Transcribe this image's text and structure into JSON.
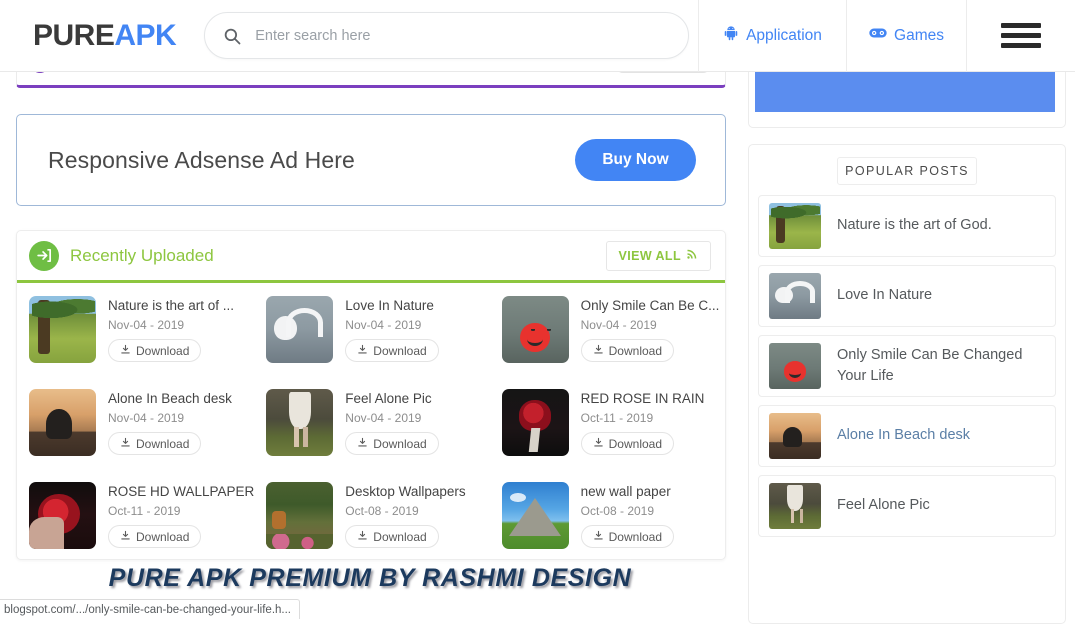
{
  "header": {
    "logo_pure": "PURE",
    "logo_apk": "APK",
    "search_placeholder": "Enter search here",
    "search_value": "",
    "nav": [
      {
        "label": "Application",
        "icon": "android-icon"
      },
      {
        "label": "Games",
        "icon": "gamepad-icon"
      }
    ],
    "menu_icon": "hamburger-menu-icon"
  },
  "ad": {
    "text": "Responsive Adsense Ad Here",
    "button_label": "Buy Now",
    "button_color": "#4285f4"
  },
  "recent": {
    "section_title": "Recently Uploaded",
    "badge_icon": "sign-in-arrow-icon",
    "view_all_label": "VIEW ALL",
    "view_all_icon": "rss-icon",
    "accent_color": "#8dc63f",
    "download_label": "Download",
    "items": [
      {
        "title": "Nature is the art of ...",
        "date": "Nov-04 - 2019",
        "art": "art-nature"
      },
      {
        "title": "Love In Nature",
        "date": "Nov-04 - 2019",
        "art": "art-swan"
      },
      {
        "title": "Only Smile Can Be C...",
        "date": "Nov-04 - 2019",
        "art": "art-smile"
      },
      {
        "title": "Alone In Beach desk",
        "date": "Nov-04 - 2019",
        "art": "art-beach"
      },
      {
        "title": "Feel Alone Pic",
        "date": "Nov-04 - 2019",
        "art": "art-forest"
      },
      {
        "title": "RED ROSE IN RAIN",
        "date": "Oct-11 - 2019",
        "art": "art-rose-dark"
      },
      {
        "title": "ROSE HD WALLPAPER",
        "date": "Oct-11 - 2019",
        "art": "art-rose-hd"
      },
      {
        "title": "Desktop Wallpapers",
        "date": "Oct-08 - 2019",
        "art": "art-deer"
      },
      {
        "title": "new wall paper",
        "date": "Oct-08 - 2019",
        "art": "art-pyramid"
      }
    ]
  },
  "sidebar": {
    "ad_color": "#5b8def",
    "popular_title": "POPULAR POSTS",
    "popular_items": [
      {
        "title": "Nature is the art of God.",
        "art": "art-nature",
        "highlighted": false
      },
      {
        "title": "Love In Nature",
        "art": "art-swan",
        "highlighted": false
      },
      {
        "title": "Only Smile Can Be Changed Your Life",
        "art": "art-smile",
        "highlighted": false
      },
      {
        "title": "Alone In Beach desk",
        "art": "art-beach",
        "highlighted": true
      },
      {
        "title": "Feel Alone Pic",
        "art": "art-forest",
        "highlighted": false
      }
    ]
  },
  "watermark": {
    "text": "PURE APK PREMIUM BY RASHMI DESIGN"
  },
  "status_bar": {
    "url": "blogspot.com/.../only-smile-can-be-changed-your-life.h..."
  }
}
